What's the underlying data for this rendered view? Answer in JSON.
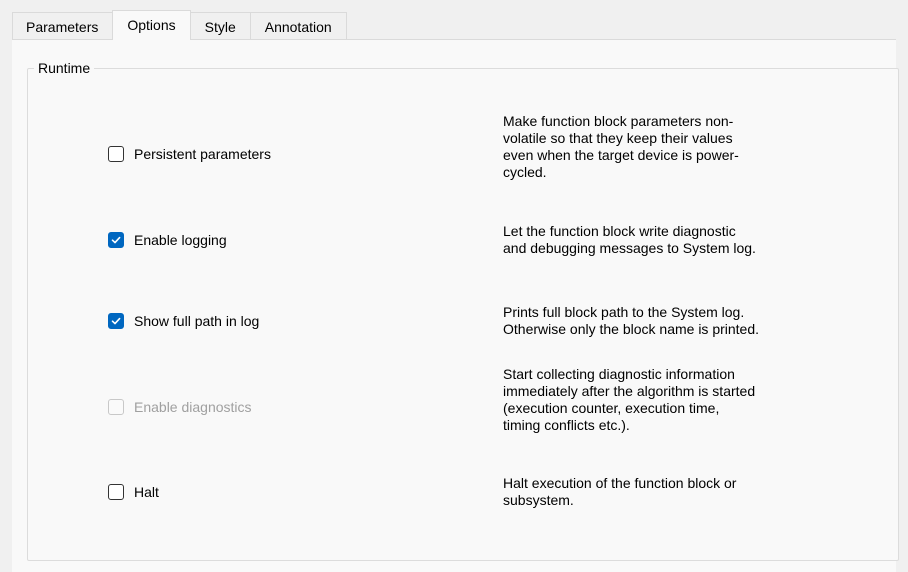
{
  "tabs": [
    {
      "label": "Parameters"
    },
    {
      "label": "Options"
    },
    {
      "label": "Style"
    },
    {
      "label": "Annotation"
    }
  ],
  "active_tab": "Options",
  "group": {
    "title": "Runtime"
  },
  "options": [
    {
      "label": "Persistent parameters",
      "checked": false,
      "enabled": true,
      "description": [
        "Make function block parameters non-",
        "volatile so that they keep their values",
        "even when the target device is power-",
        "cycled."
      ]
    },
    {
      "label": "Enable logging",
      "checked": true,
      "enabled": true,
      "description": [
        "Let the function block write diagnostic",
        "and debugging messages to System log."
      ]
    },
    {
      "label": "Show full path in log",
      "checked": true,
      "enabled": true,
      "description": [
        "Prints full block path to the System log.",
        "Otherwise only the block name is printed."
      ]
    },
    {
      "label": "Enable diagnostics",
      "checked": false,
      "enabled": false,
      "description": [
        "Start collecting diagnostic information",
        "immediately after the algorithm is started",
        "(execution counter, execution time,",
        "timing conflicts etc.)."
      ]
    },
    {
      "label": "Halt",
      "checked": false,
      "enabled": true,
      "description": [
        "Halt execution of the function block or",
        "subsystem."
      ]
    }
  ],
  "colors": {
    "accent": "#0067c0",
    "disabled_text": "#a0a0a0",
    "panel_bg": "#f9f9f9",
    "window_bg": "#f0f0f0"
  }
}
